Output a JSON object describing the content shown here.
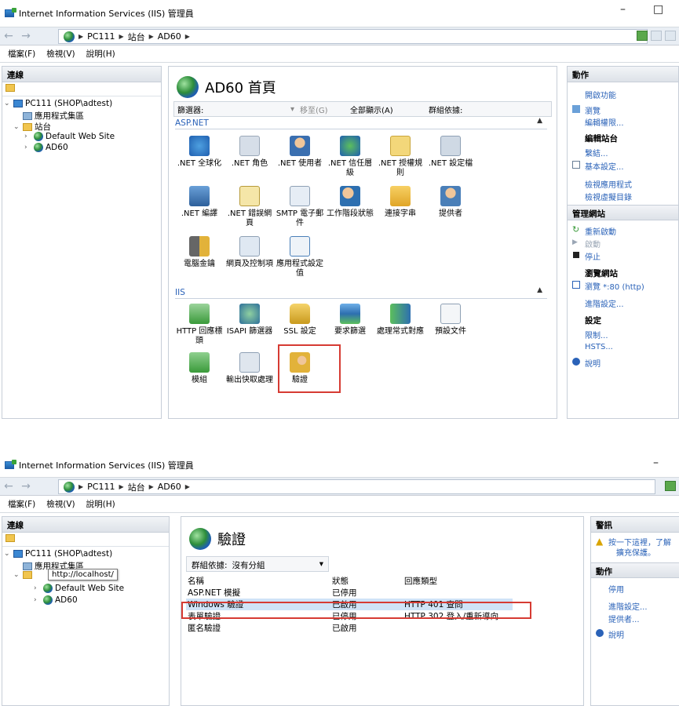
{
  "window_title": "Internet Information Services (IIS) 管理員",
  "window_controls": {
    "minimize": "–",
    "maximize": "□"
  },
  "breadcrumb": [
    "PC111",
    "站台",
    "AD60"
  ],
  "menu": [
    "檔案(F)",
    "檢視(V)",
    "說明(H)"
  ],
  "connections": {
    "title": "連線",
    "server": "PC111 (SHOP\\adtest)",
    "app_pools": "應用程式集區",
    "sites": "站台",
    "site_default": "Default Web Site",
    "site_ad60": "AD60",
    "tooltip": "http://localhost/"
  },
  "home": {
    "title": "AD60 首頁",
    "filter_label": "篩選器:",
    "goto": "移至(G)",
    "show_all": "全部顯示(A)",
    "group_by": "群組依據:",
    "section_aspnet": "ASP.NET",
    "section_iis": "IIS",
    "aspnet_items": [
      ".NET 全球化",
      ".NET 角色",
      ".NET 使用者",
      ".NET 信任層級",
      ".NET 授權規則",
      ".NET 設定檔",
      ".NET 編譯",
      ".NET 錯誤網頁",
      "SMTP 電子郵件",
      "工作階段狀態",
      "連接字串",
      "提供者",
      "電腦金鑰",
      "網頁及控制項",
      "應用程式設定值"
    ],
    "iis_items": [
      "HTTP 回應標頭",
      "ISAPI 篩選器",
      "SSL 設定",
      "要求篩選",
      "處理常式對應",
      "預設文件",
      "模組",
      "輸出快取處理",
      "驗證"
    ]
  },
  "actions1": {
    "title": "動作",
    "open_feature": "開啟功能",
    "browse": "瀏覽",
    "edit_permissions": "編輯權限...",
    "edit_site": "編輯站台",
    "bindings": "繫結...",
    "basic_settings": "基本設定...",
    "view_apps": "檢視應用程式",
    "view_vdirs": "檢視虛擬目錄",
    "manage_site": "管理網站",
    "restart": "重新啟動",
    "start": "啟動",
    "stop": "停止",
    "browse_site": "瀏覽網站",
    "browse_80": "瀏覽 *:80 (http)",
    "advanced": "進階設定...",
    "config": "設定",
    "limits": "限制...",
    "hsts": "HSTS...",
    "help": "說明"
  },
  "auth": {
    "title": "驗證",
    "group_by_label": "群組依據:",
    "group_by_value": "沒有分組",
    "columns": [
      "名稱",
      "狀態",
      "回應類型"
    ],
    "rows": [
      [
        "ASP.NET 模擬",
        "已停用",
        ""
      ],
      [
        "Windows 驗證",
        "已啟用",
        "HTTP 401 查問"
      ],
      [
        "表單驗證",
        "已停用",
        "HTTP 302 登入/重新導向"
      ],
      [
        "匿名驗證",
        "已啟用",
        ""
      ]
    ]
  },
  "actions2": {
    "alerts_title": "警訊",
    "alert_text_1": "按一下這裡，了解",
    "alert_text_2": "擴充保護。",
    "actions_title": "動作",
    "disable": "停用",
    "advanced": "進階設定...",
    "providers": "提供者...",
    "help": "說明"
  },
  "colors": {
    "accent": "#2a62b8",
    "highlight": "#d63b33"
  }
}
